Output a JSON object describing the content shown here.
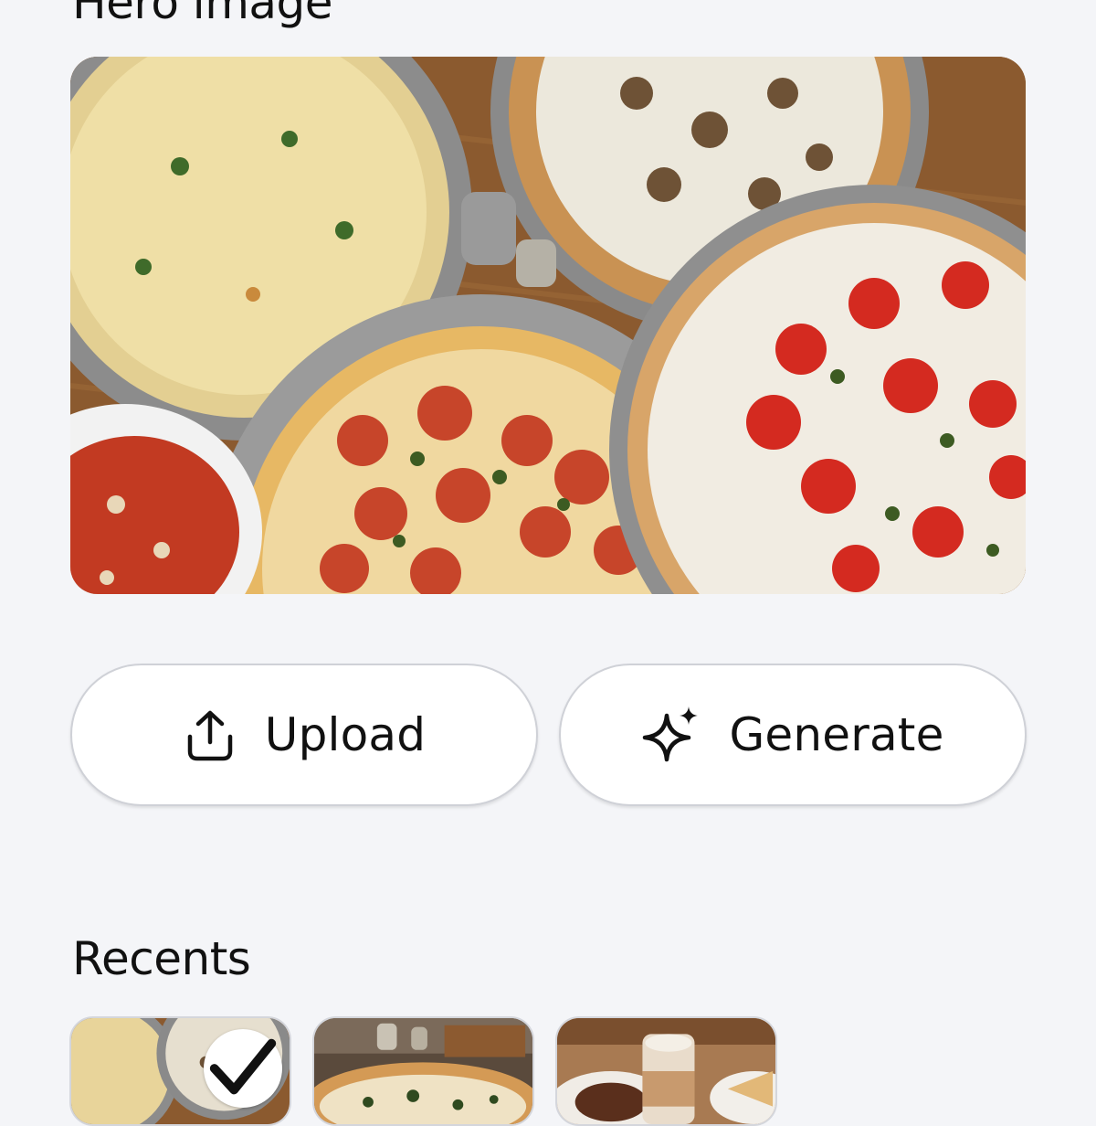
{
  "hero_section": {
    "title": "Hero image",
    "image": "pizza-spread-photo"
  },
  "actions": {
    "upload_label": "Upload",
    "upload_icon": "upload-icon",
    "generate_label": "Generate",
    "generate_icon": "sparkle-icon"
  },
  "recents": {
    "title": "Recents",
    "items": [
      {
        "image": "pizza-spread-photo",
        "selected": true
      },
      {
        "image": "spinach-pizza-photo",
        "selected": false
      },
      {
        "image": "latte-and-dessert-photo",
        "selected": false
      }
    ]
  },
  "colors": {
    "background": "#f4f5f8",
    "button_fill": "#ffffff",
    "button_border": "#cfd1d7",
    "text": "#111111"
  }
}
